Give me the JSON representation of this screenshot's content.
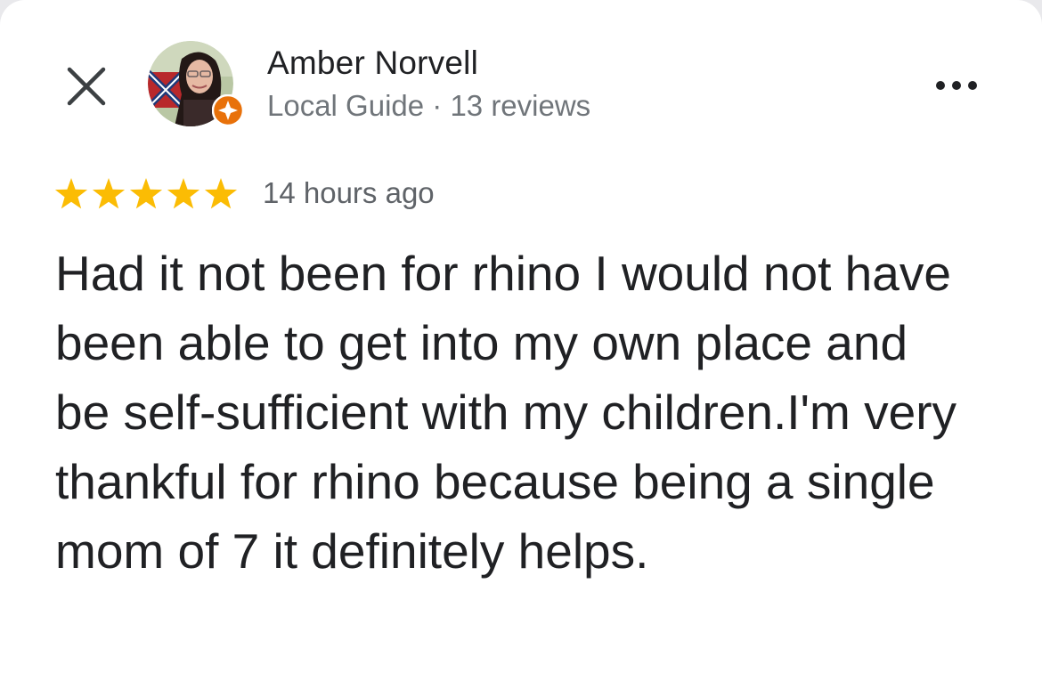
{
  "reviewer": {
    "name": "Amber Norvell",
    "meta": "Local Guide · 13 reviews"
  },
  "review": {
    "rating": 5,
    "rating_max": 5,
    "time_ago": "14 hours ago",
    "text": "Had it not been for rhino I would not have been able to get into my own place and be self-sufficient with my children.I'm very thankful for rhino because being a single mom of 7 it definitely helps."
  },
  "icons": {
    "close": "close-icon",
    "more": "more-options-icon",
    "badge": "local-guide-badge-icon",
    "star": "star-icon"
  },
  "colors": {
    "star": "#fbbc04",
    "badge": "#e8710a",
    "text": "#202124",
    "secondary_text": "#70757a"
  }
}
